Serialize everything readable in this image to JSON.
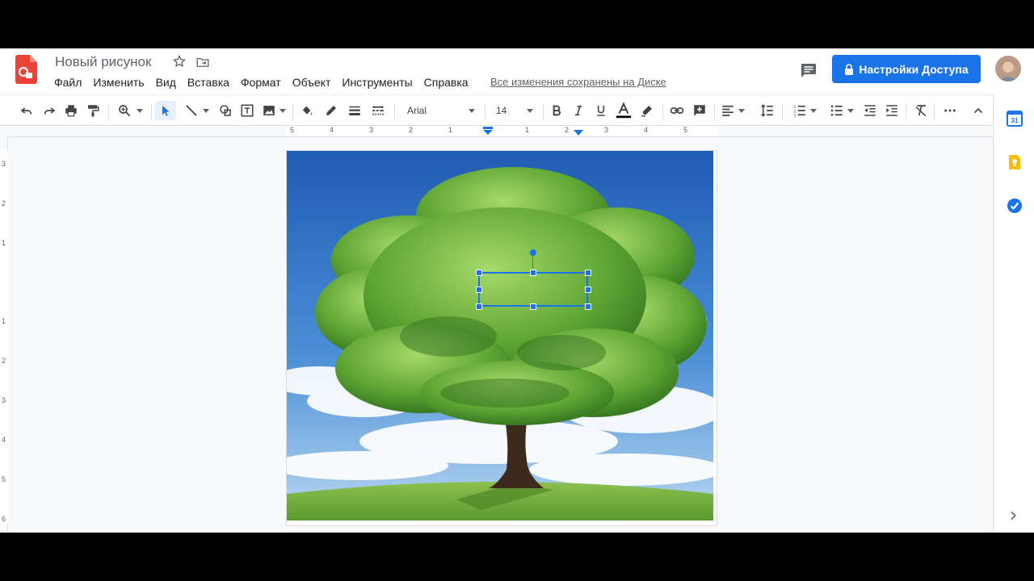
{
  "document": {
    "title": "Новый рисунок",
    "save_status": "Все изменения сохранены на Диске"
  },
  "menu": [
    "Файл",
    "Изменить",
    "Вид",
    "Вставка",
    "Формат",
    "Объект",
    "Инструменты",
    "Справка"
  ],
  "share": {
    "label": "Настройки Доступа"
  },
  "toolbar": {
    "font_family": "Arial",
    "font_size": "14"
  },
  "hruler": {
    "labels": [
      "5",
      "4",
      "3",
      "2",
      "1",
      "1",
      "2",
      "3",
      "4",
      "5"
    ]
  },
  "vruler": {
    "labels": [
      "3",
      "2",
      "1",
      "1",
      "2",
      "3",
      "4",
      "5",
      "6"
    ]
  },
  "side_panel": {
    "calendar_label": "31"
  },
  "colors": {
    "accent": "#1a73e8",
    "logo": "#ea4335",
    "sky": "#2a66b8",
    "grass": "#6aa63a"
  }
}
